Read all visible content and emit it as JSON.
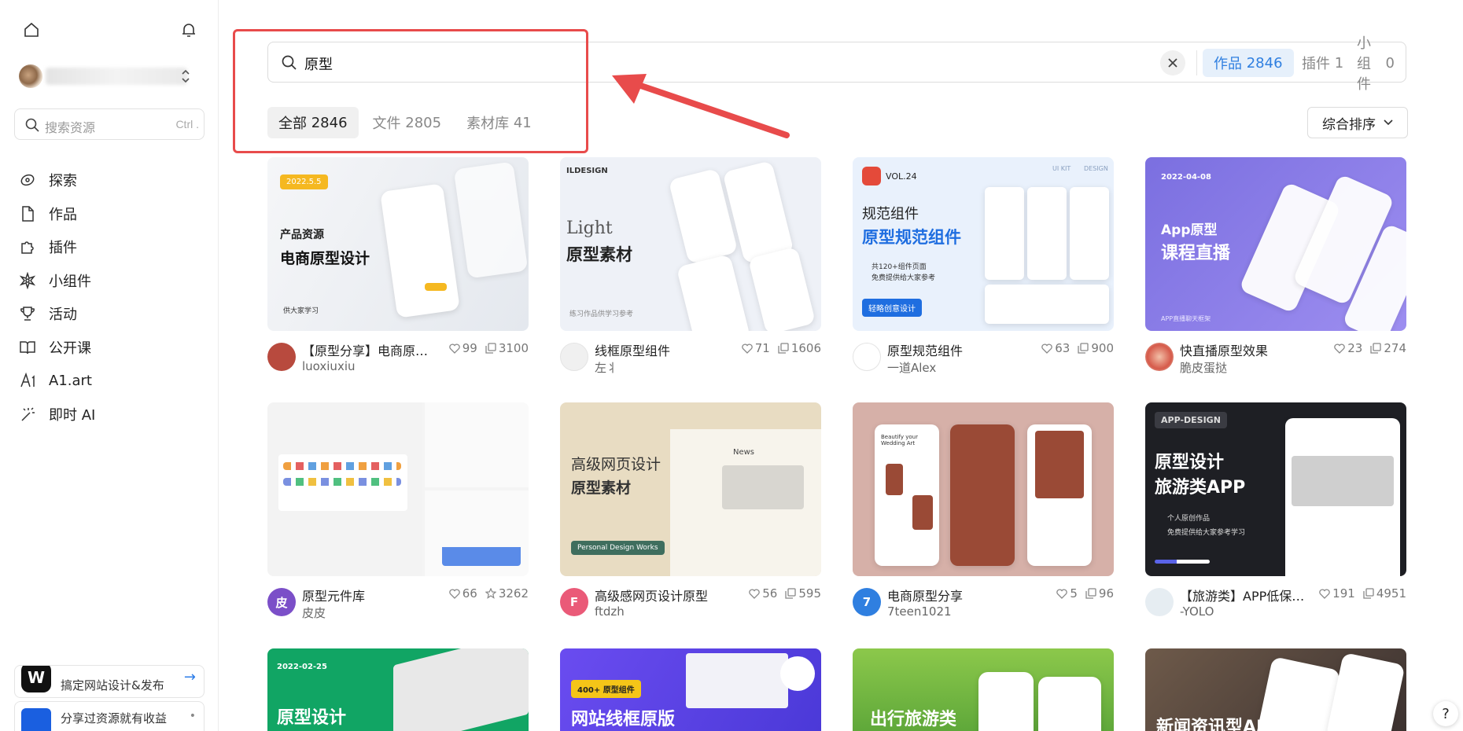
{
  "sidebar": {
    "search_placeholder": "搜索资源",
    "search_shortcut": "Ctrl .",
    "nav": [
      {
        "label": "探索",
        "icon": "explore-icon"
      },
      {
        "label": "作品",
        "icon": "file-icon"
      },
      {
        "label": "插件",
        "icon": "puzzle-icon"
      },
      {
        "label": "小组件",
        "icon": "widget-icon"
      },
      {
        "label": "活动",
        "icon": "trophy-icon"
      },
      {
        "label": "公开课",
        "icon": "book-icon"
      },
      {
        "label": "A1.art",
        "icon": "a1-art-icon"
      },
      {
        "label": "即时 AI",
        "icon": "magic-wand-icon"
      }
    ],
    "promo1_text": "搞定网站设计&发布",
    "promo2_text": "分享过资源就有收益"
  },
  "search": {
    "query": "原型",
    "type_tabs": [
      {
        "label": "作品",
        "count": "2846",
        "active": true
      },
      {
        "label": "插件",
        "count": "1",
        "active": false
      },
      {
        "label": "小组件",
        "count": "0",
        "active": false
      }
    ]
  },
  "filters": [
    {
      "label": "全部",
      "count": "2846",
      "active": true
    },
    {
      "label": "文件",
      "count": "2805",
      "active": false
    },
    {
      "label": "素材库",
      "count": "41",
      "active": false
    }
  ],
  "sort_label": "综合排序",
  "cards": [
    {
      "title": "【原型分享】电商原型设计",
      "author": "luoxiuxiu",
      "likes": "99",
      "copies": "3100",
      "avatar_letter": "",
      "avatar_color": "#b84a3e",
      "thumb": {
        "badge": "2022.5.5",
        "kicker": "产品资源",
        "title": "电商原型设计",
        "footer": "供大家学习"
      }
    },
    {
      "title": "线框原型组件",
      "author": "左丬",
      "likes": "71",
      "copies": "1606",
      "avatar_letter": "",
      "avatar_color": "#eeeeee",
      "thumb": {
        "brand": "ILDESIGN",
        "kicker": "Light",
        "title": "原型素材",
        "footer": "练习作品供学习参考"
      }
    },
    {
      "title": "原型规范组件",
      "author": "一道Alex",
      "likes": "63",
      "copies": "900",
      "avatar_letter": "",
      "avatar_color": "#f2f2f2",
      "thumb": {
        "brand": "VOL.24",
        "kicker": "规范组件",
        "title": "原型规范组件",
        "bullet1": "共120+组件页面",
        "bullet2": "免费提供给大家参考",
        "button": "轻略创意设计",
        "tag1": "UI KIT",
        "tag2": "DESIGN"
      }
    },
    {
      "title": "快直播原型效果",
      "author": "脆皮蛋挞",
      "likes": "23",
      "copies": "274",
      "avatar_letter": "",
      "avatar_color": "#d65a4a",
      "thumb": {
        "badge": "2022-04-08",
        "kicker": "App原型",
        "title": "课程直播",
        "footer": "APP直播聊天框架"
      }
    },
    {
      "title": "原型元件库",
      "author": "皮皮",
      "likes": "66",
      "copies": "3262",
      "avatar_letter": "皮",
      "avatar_color": "#7b4fc8",
      "star": true,
      "thumb": {}
    },
    {
      "title": "高级感网页设计原型",
      "author": "ftdzh",
      "likes": "56",
      "copies": "595",
      "avatar_letter": "F",
      "avatar_color": "#ea5a78",
      "thumb": {
        "kicker": "高级网页设计",
        "title": "原型素材",
        "button": "Personal Design Works",
        "news": "News"
      }
    },
    {
      "title": "电商原型分享",
      "author": "7teen1021",
      "likes": "5",
      "copies": "96",
      "avatar_letter": "7",
      "avatar_color": "#2f7fe0",
      "thumb": {
        "phone_text": "Beautify your Wedding Art"
      }
    },
    {
      "title": "【旅游类】APP低保真原型",
      "author": "-YOLO",
      "likes": "191",
      "copies": "4951",
      "avatar_letter": "",
      "avatar_color": "#dfe6ec",
      "thumb": {
        "badge": "APP-DESIGN",
        "kicker": "原型设计",
        "title": "旅游类APP",
        "bullet1": "个人原创作品",
        "bullet2": "免费提供给大家参考学习"
      }
    },
    {
      "thumb": {
        "badge": "2022-02-25",
        "title": "原型设计"
      }
    },
    {
      "thumb": {
        "badge": "400+ 原型组件",
        "title": "网站线框原版"
      }
    },
    {
      "thumb": {
        "title": "出行旅游类"
      }
    },
    {
      "thumb": {
        "title": "新闻资讯型APP"
      }
    }
  ],
  "help": "?",
  "colors": {
    "accent": "#2f7fe0",
    "annotation": "#e84b4b"
  }
}
